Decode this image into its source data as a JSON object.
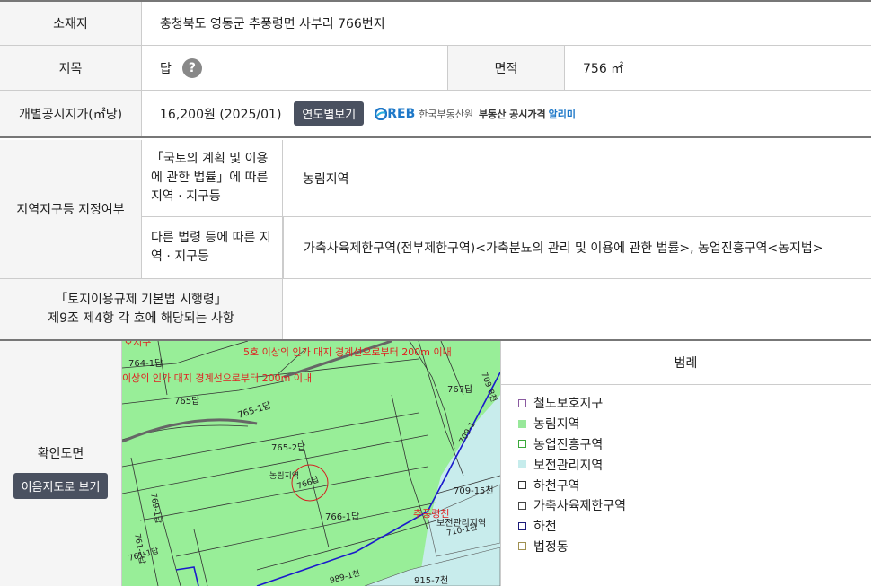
{
  "location": {
    "label": "소재지",
    "value": "충청북도 영동군 추풍령면 사부리 766번지"
  },
  "land_category": {
    "label": "지목",
    "value": "답",
    "help": "?"
  },
  "area": {
    "label": "면적",
    "value": "756 ㎡"
  },
  "price": {
    "label": "개별공시지가(㎡당)",
    "value": "16,200원 (2025/01)",
    "button": "연도별보기",
    "reb_logo": "REB",
    "reb_org": "한국부동산원",
    "reb_service": "부동산 공시가격",
    "reb_alimi": "알리미"
  },
  "zoning": {
    "label": "지역지구등 지정여부",
    "sub1_label": "「국토의 계획 및 이용에 관한 법률」에 따른 지역 · 지구등",
    "sub1_value": "농림지역",
    "sub2_label": "다른 법령 등에 따른 지역 · 지구등",
    "sub2_value": "가축사육제한구역(전부제한구역)<가축분뇨의 관리 및 이용에 관한 법률>, 농업진흥구역<농지법>"
  },
  "enforcement": {
    "label_line1": "「토지이용규제 기본법 시행령」",
    "label_line2": "제9조 제4항 각 호에 해당되는 사항",
    "value": ""
  },
  "map_section": {
    "label": "확인도면",
    "button": "이음지도로 보기",
    "map_labels": {
      "red_top_left": "호지구",
      "red_top_line": "5호 이상의 인가 대지 경계선으로부터 200m 이내",
      "red_mid_line": "이상의 인가 대지 경계선으로부터 200m 이내",
      "parcel_764_1": "764-1답",
      "parcel_765": "765답",
      "parcel_765_1": "765-1답",
      "parcel_765_2": "765-2답",
      "parcel_767": "767답",
      "parcel_709_8": "709-8천",
      "parcel_766": "766답",
      "zone_label": "농림지역",
      "parcel_766_1": "766-1답",
      "parcel_709_15": "709-15천",
      "red_chupung": "추풍령천",
      "bojeon": "보전관리지역",
      "parcel_710_1": "710-1천",
      "parcel_915_7": "915-7천",
      "parcel_989_1": "989-1천",
      "parcel_761_2": "761-2답",
      "parcel_761_1": "761-1답",
      "parcel_769_1": "769-1답",
      "parcel_1": "709-1"
    },
    "legend_title": "범례",
    "legend": [
      {
        "label": "철도보호지구",
        "fill": "#ffffff",
        "border": "#8a5aa0"
      },
      {
        "label": "농림지역",
        "fill": "#98e89a",
        "border": "#98e89a"
      },
      {
        "label": "농업진흥구역",
        "fill": "#ffffff",
        "border": "#3aa83a"
      },
      {
        "label": "보전관리지역",
        "fill": "#c6ecec",
        "border": "#c6ecec"
      },
      {
        "label": "하천구역",
        "fill": "#ffffff",
        "border": "#333333"
      },
      {
        "label": "가축사육제한구역",
        "fill": "#ffffff",
        "border": "#444444"
      },
      {
        "label": "하천",
        "fill": "#ffffff",
        "border": "#1a1a7a"
      },
      {
        "label": "법정동",
        "fill": "#ffffff",
        "border": "#a09050"
      }
    ]
  }
}
